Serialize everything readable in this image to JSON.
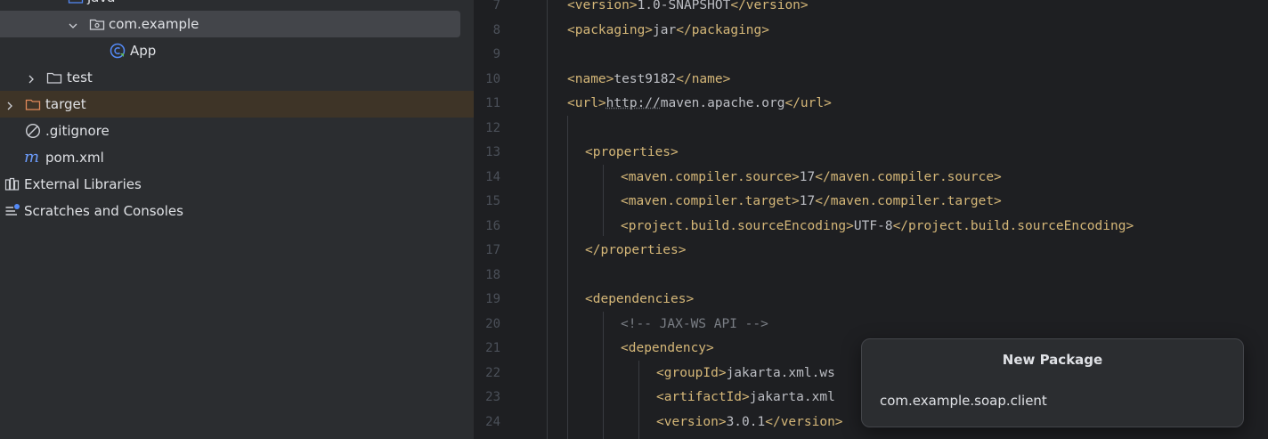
{
  "project_tree": {
    "items": [
      {
        "label": "java",
        "icon": "source-folder-icon"
      },
      {
        "label": "com.example",
        "icon": "package-icon",
        "expanded": true,
        "selected": true
      },
      {
        "label": "App",
        "icon": "java-class-icon"
      },
      {
        "label": "test",
        "icon": "folder-icon",
        "expanded": false
      },
      {
        "label": "target",
        "icon": "excluded-folder-icon",
        "expanded": false
      },
      {
        "label": ".gitignore",
        "icon": "ignored-file-icon"
      },
      {
        "label": "pom.xml",
        "icon": "maven-icon"
      },
      {
        "label": "External Libraries",
        "icon": "libraries-icon"
      },
      {
        "label": "Scratches and Consoles",
        "icon": "scratches-icon"
      }
    ]
  },
  "editor": {
    "lines": [
      {
        "num": "7",
        "parts": [
          {
            "t": "<version>",
            "c": "tag"
          },
          {
            "t": "1.0-SNAPSHOT",
            "c": "txt"
          },
          {
            "t": "</version>",
            "c": "tag"
          }
        ]
      },
      {
        "num": "8",
        "parts": [
          {
            "t": "<packaging>",
            "c": "tag"
          },
          {
            "t": "jar",
            "c": "txt"
          },
          {
            "t": "</packaging>",
            "c": "tag"
          }
        ]
      },
      {
        "num": "9",
        "parts": []
      },
      {
        "num": "10",
        "parts": [
          {
            "t": "<name>",
            "c": "tag"
          },
          {
            "t": "test9182",
            "c": "txt"
          },
          {
            "t": "</name>",
            "c": "tag"
          }
        ]
      },
      {
        "num": "11",
        "parts": [
          {
            "t": "<url>",
            "c": "tag"
          },
          {
            "t": "http://",
            "c": "url"
          },
          {
            "t": "maven.apache.org",
            "c": "txt"
          },
          {
            "t": "</url>",
            "c": "tag"
          }
        ]
      },
      {
        "num": "12",
        "parts": []
      },
      {
        "num": "13",
        "parts": [
          {
            "t": "<properties>",
            "c": "tag"
          }
        ]
      },
      {
        "num": "14",
        "parts": [
          {
            "t": "<maven.compiler.source>",
            "c": "tag"
          },
          {
            "t": "17",
            "c": "txt"
          },
          {
            "t": "</maven.compiler.source>",
            "c": "tag"
          }
        ]
      },
      {
        "num": "15",
        "parts": [
          {
            "t": "<maven.compiler.target>",
            "c": "tag"
          },
          {
            "t": "17",
            "c": "txt"
          },
          {
            "t": "</maven.compiler.target>",
            "c": "tag"
          }
        ]
      },
      {
        "num": "16",
        "parts": [
          {
            "t": "<project.build.sourceEncoding>",
            "c": "tag"
          },
          {
            "t": "UTF-8",
            "c": "txt"
          },
          {
            "t": "</project.build.sourceEncoding>",
            "c": "tag"
          }
        ]
      },
      {
        "num": "17",
        "parts": [
          {
            "t": "</properties>",
            "c": "tag"
          }
        ]
      },
      {
        "num": "18",
        "parts": []
      },
      {
        "num": "19",
        "parts": [
          {
            "t": "<dependencies>",
            "c": "tag"
          }
        ]
      },
      {
        "num": "20",
        "parts": [
          {
            "t": "<!-- JAX-WS API -->",
            "c": "cmt"
          }
        ]
      },
      {
        "num": "21",
        "parts": [
          {
            "t": "<dependency>",
            "c": "tag"
          }
        ]
      },
      {
        "num": "22",
        "parts": [
          {
            "t": "<groupId>",
            "c": "tag"
          },
          {
            "t": "jakarta.xml.ws",
            "c": "txt"
          }
        ]
      },
      {
        "num": "23",
        "parts": [
          {
            "t": "<artifactId>",
            "c": "tag"
          },
          {
            "t": "jakarta.xml",
            "c": "txt"
          }
        ]
      },
      {
        "num": "24",
        "parts": [
          {
            "t": "<version>",
            "c": "tag"
          },
          {
            "t": "3.0.1",
            "c": "txt"
          },
          {
            "t": "</version>",
            "c": "tag"
          }
        ]
      }
    ]
  },
  "new_package_dialog": {
    "title": "New Package",
    "value": "com.example.soap.client"
  },
  "colors": {
    "tag": "#d5b778",
    "comment": "#7a7e85",
    "text": "#bcbec4",
    "selection": "#43454a",
    "target_highlight": "#3e3427"
  }
}
